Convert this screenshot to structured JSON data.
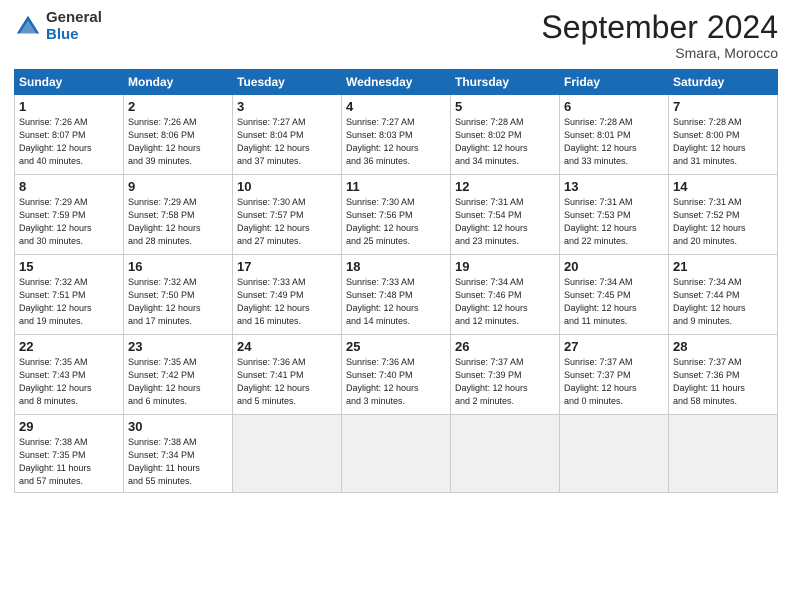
{
  "logo": {
    "general": "General",
    "blue": "Blue"
  },
  "header": {
    "month": "September 2024",
    "location": "Smara, Morocco"
  },
  "weekdays": [
    "Sunday",
    "Monday",
    "Tuesday",
    "Wednesday",
    "Thursday",
    "Friday",
    "Saturday"
  ],
  "weeks": [
    [
      {
        "day": 1,
        "detail": "Sunrise: 7:26 AM\nSunset: 8:07 PM\nDaylight: 12 hours\nand 40 minutes."
      },
      {
        "day": 2,
        "detail": "Sunrise: 7:26 AM\nSunset: 8:06 PM\nDaylight: 12 hours\nand 39 minutes."
      },
      {
        "day": 3,
        "detail": "Sunrise: 7:27 AM\nSunset: 8:04 PM\nDaylight: 12 hours\nand 37 minutes."
      },
      {
        "day": 4,
        "detail": "Sunrise: 7:27 AM\nSunset: 8:03 PM\nDaylight: 12 hours\nand 36 minutes."
      },
      {
        "day": 5,
        "detail": "Sunrise: 7:28 AM\nSunset: 8:02 PM\nDaylight: 12 hours\nand 34 minutes."
      },
      {
        "day": 6,
        "detail": "Sunrise: 7:28 AM\nSunset: 8:01 PM\nDaylight: 12 hours\nand 33 minutes."
      },
      {
        "day": 7,
        "detail": "Sunrise: 7:28 AM\nSunset: 8:00 PM\nDaylight: 12 hours\nand 31 minutes."
      }
    ],
    [
      {
        "day": 8,
        "detail": "Sunrise: 7:29 AM\nSunset: 7:59 PM\nDaylight: 12 hours\nand 30 minutes."
      },
      {
        "day": 9,
        "detail": "Sunrise: 7:29 AM\nSunset: 7:58 PM\nDaylight: 12 hours\nand 28 minutes."
      },
      {
        "day": 10,
        "detail": "Sunrise: 7:30 AM\nSunset: 7:57 PM\nDaylight: 12 hours\nand 27 minutes."
      },
      {
        "day": 11,
        "detail": "Sunrise: 7:30 AM\nSunset: 7:56 PM\nDaylight: 12 hours\nand 25 minutes."
      },
      {
        "day": 12,
        "detail": "Sunrise: 7:31 AM\nSunset: 7:54 PM\nDaylight: 12 hours\nand 23 minutes."
      },
      {
        "day": 13,
        "detail": "Sunrise: 7:31 AM\nSunset: 7:53 PM\nDaylight: 12 hours\nand 22 minutes."
      },
      {
        "day": 14,
        "detail": "Sunrise: 7:31 AM\nSunset: 7:52 PM\nDaylight: 12 hours\nand 20 minutes."
      }
    ],
    [
      {
        "day": 15,
        "detail": "Sunrise: 7:32 AM\nSunset: 7:51 PM\nDaylight: 12 hours\nand 19 minutes."
      },
      {
        "day": 16,
        "detail": "Sunrise: 7:32 AM\nSunset: 7:50 PM\nDaylight: 12 hours\nand 17 minutes."
      },
      {
        "day": 17,
        "detail": "Sunrise: 7:33 AM\nSunset: 7:49 PM\nDaylight: 12 hours\nand 16 minutes."
      },
      {
        "day": 18,
        "detail": "Sunrise: 7:33 AM\nSunset: 7:48 PM\nDaylight: 12 hours\nand 14 minutes."
      },
      {
        "day": 19,
        "detail": "Sunrise: 7:34 AM\nSunset: 7:46 PM\nDaylight: 12 hours\nand 12 minutes."
      },
      {
        "day": 20,
        "detail": "Sunrise: 7:34 AM\nSunset: 7:45 PM\nDaylight: 12 hours\nand 11 minutes."
      },
      {
        "day": 21,
        "detail": "Sunrise: 7:34 AM\nSunset: 7:44 PM\nDaylight: 12 hours\nand 9 minutes."
      }
    ],
    [
      {
        "day": 22,
        "detail": "Sunrise: 7:35 AM\nSunset: 7:43 PM\nDaylight: 12 hours\nand 8 minutes."
      },
      {
        "day": 23,
        "detail": "Sunrise: 7:35 AM\nSunset: 7:42 PM\nDaylight: 12 hours\nand 6 minutes."
      },
      {
        "day": 24,
        "detail": "Sunrise: 7:36 AM\nSunset: 7:41 PM\nDaylight: 12 hours\nand 5 minutes."
      },
      {
        "day": 25,
        "detail": "Sunrise: 7:36 AM\nSunset: 7:40 PM\nDaylight: 12 hours\nand 3 minutes."
      },
      {
        "day": 26,
        "detail": "Sunrise: 7:37 AM\nSunset: 7:39 PM\nDaylight: 12 hours\nand 2 minutes."
      },
      {
        "day": 27,
        "detail": "Sunrise: 7:37 AM\nSunset: 7:37 PM\nDaylight: 12 hours\nand 0 minutes."
      },
      {
        "day": 28,
        "detail": "Sunrise: 7:37 AM\nSunset: 7:36 PM\nDaylight: 11 hours\nand 58 minutes."
      }
    ],
    [
      {
        "day": 29,
        "detail": "Sunrise: 7:38 AM\nSunset: 7:35 PM\nDaylight: 11 hours\nand 57 minutes."
      },
      {
        "day": 30,
        "detail": "Sunrise: 7:38 AM\nSunset: 7:34 PM\nDaylight: 11 hours\nand 55 minutes."
      },
      null,
      null,
      null,
      null,
      null
    ]
  ]
}
